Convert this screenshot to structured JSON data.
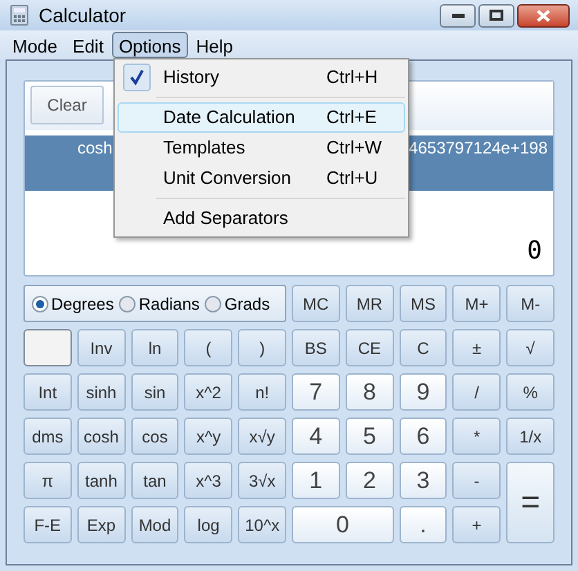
{
  "window": {
    "title": "Calculator"
  },
  "menu_bar": [
    {
      "label": "Mode",
      "selected": false
    },
    {
      "label": "Edit",
      "selected": false
    },
    {
      "label": "Options",
      "selected": true
    },
    {
      "label": "Help",
      "selected": false
    }
  ],
  "options_menu": [
    {
      "kind": "item",
      "label": "History",
      "shortcut": "Ctrl+H",
      "checked": true,
      "selected": false
    },
    {
      "kind": "separator"
    },
    {
      "kind": "item",
      "label": "Date Calculation",
      "shortcut": "Ctrl+E",
      "checked": false,
      "selected": true
    },
    {
      "kind": "item",
      "label": "Templates",
      "shortcut": "Ctrl+W",
      "checked": false,
      "selected": false
    },
    {
      "kind": "item",
      "label": "Unit Conversion",
      "shortcut": "Ctrl+U",
      "checked": false,
      "selected": false
    },
    {
      "kind": "separator"
    },
    {
      "kind": "item",
      "label": "Add Separators",
      "checked": false,
      "selected": false
    }
  ],
  "history": {
    "clear_button": "Clear",
    "rows": [
      {
        "expression": "cosh",
        "result": "4653797124e+198",
        "selected": true
      }
    ]
  },
  "display": {
    "value": "0"
  },
  "angle_units": [
    {
      "label": "Degrees",
      "selected": true
    },
    {
      "label": "Radians",
      "selected": false
    },
    {
      "label": "Grads",
      "selected": false
    }
  ],
  "keys": [
    {
      "kind": "func",
      "label": "MC"
    },
    {
      "kind": "func",
      "label": "MR"
    },
    {
      "kind": "func",
      "label": "MS"
    },
    {
      "kind": "func",
      "label": "M+"
    },
    {
      "kind": "func",
      "label": "M-"
    },
    {
      "kind": "blank"
    },
    {
      "kind": "func",
      "label": "Inv"
    },
    {
      "kind": "func",
      "label": "ln"
    },
    {
      "kind": "func",
      "label": "("
    },
    {
      "kind": "func",
      "label": ")"
    },
    {
      "kind": "func",
      "label": "BS"
    },
    {
      "kind": "func",
      "label": "CE"
    },
    {
      "kind": "func",
      "label": "C"
    },
    {
      "kind": "func",
      "label": "±"
    },
    {
      "kind": "func",
      "label": "√"
    },
    {
      "kind": "func",
      "label": "Int"
    },
    {
      "kind": "func",
      "label": "sinh"
    },
    {
      "kind": "func",
      "label": "sin"
    },
    {
      "kind": "func",
      "label": "x^2"
    },
    {
      "kind": "func",
      "label": "n!"
    },
    {
      "kind": "digit",
      "label": "7"
    },
    {
      "kind": "digit",
      "label": "8"
    },
    {
      "kind": "digit",
      "label": "9"
    },
    {
      "kind": "func",
      "label": "/"
    },
    {
      "kind": "func",
      "label": "%"
    },
    {
      "kind": "func",
      "label": "dms"
    },
    {
      "kind": "func",
      "label": "cosh"
    },
    {
      "kind": "func",
      "label": "cos"
    },
    {
      "kind": "func",
      "label": "x^y"
    },
    {
      "kind": "func",
      "label": "x√y"
    },
    {
      "kind": "digit",
      "label": "4"
    },
    {
      "kind": "digit",
      "label": "5"
    },
    {
      "kind": "digit",
      "label": "6"
    },
    {
      "kind": "func",
      "label": "*"
    },
    {
      "kind": "func",
      "label": "1/x"
    },
    {
      "kind": "func",
      "label": "π"
    },
    {
      "kind": "func",
      "label": "tanh"
    },
    {
      "kind": "func",
      "label": "tan"
    },
    {
      "kind": "func",
      "label": "x^3"
    },
    {
      "kind": "func",
      "label": "3√x"
    },
    {
      "kind": "digit",
      "label": "1"
    },
    {
      "kind": "digit",
      "label": "2"
    },
    {
      "kind": "digit",
      "label": "3"
    },
    {
      "kind": "func",
      "label": "-"
    },
    {
      "kind": "equals",
      "label": "="
    },
    {
      "kind": "func",
      "label": "F-E"
    },
    {
      "kind": "func",
      "label": "Exp"
    },
    {
      "kind": "func",
      "label": "Mod"
    },
    {
      "kind": "func",
      "label": "log"
    },
    {
      "kind": "func",
      "label": "10^x"
    },
    {
      "kind": "zero",
      "label": "0"
    },
    {
      "kind": "digit",
      "label": "."
    },
    {
      "kind": "func",
      "label": "+"
    }
  ]
}
